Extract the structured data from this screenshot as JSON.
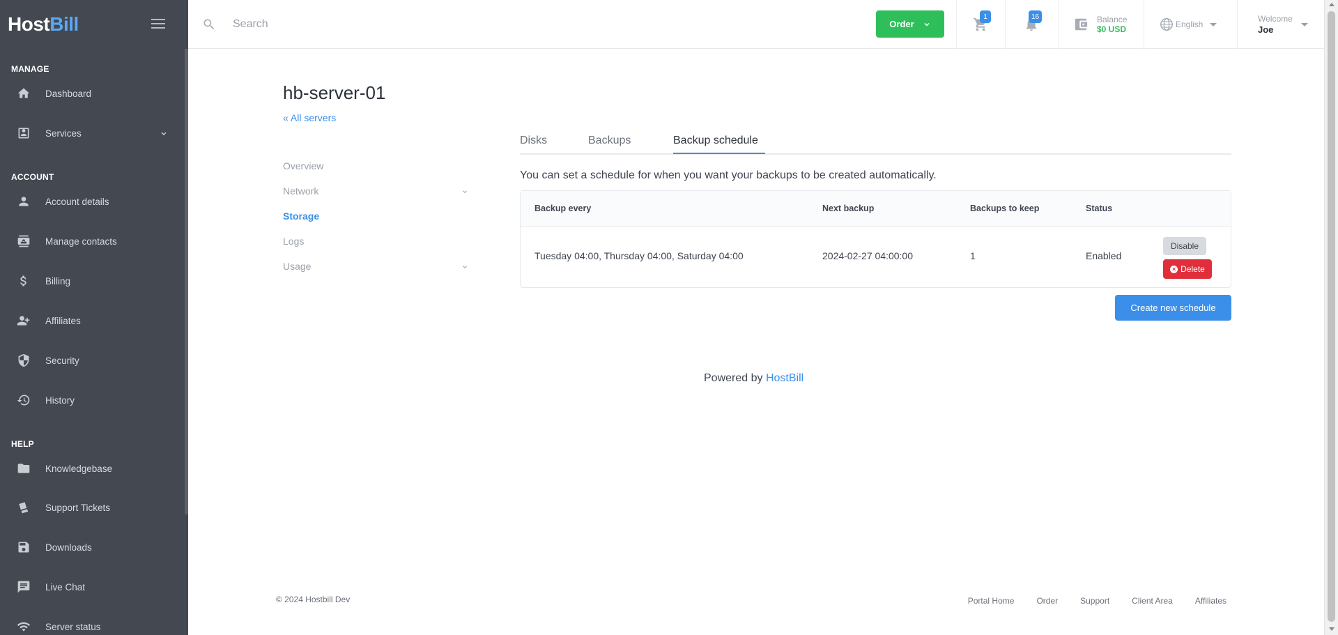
{
  "sidebar": {
    "logo_host": "Host",
    "logo_bill": "Bill",
    "sections": {
      "manage": "MANAGE",
      "account": "ACCOUNT",
      "help": "HELP"
    },
    "items": [
      {
        "label": "Dashboard",
        "icon": "home-icon"
      },
      {
        "label": "Services",
        "icon": "services-icon"
      },
      {
        "label": "Account details",
        "icon": "person-icon"
      },
      {
        "label": "Manage contacts",
        "icon": "contacts-icon"
      },
      {
        "label": "Billing",
        "icon": "dollar-icon"
      },
      {
        "label": "Affiliates",
        "icon": "affiliates-icon"
      },
      {
        "label": "Security",
        "icon": "shield-icon"
      },
      {
        "label": "History",
        "icon": "history-icon"
      },
      {
        "label": "Knowledgebase",
        "icon": "folder-icon"
      },
      {
        "label": "Support Tickets",
        "icon": "ticket-icon"
      },
      {
        "label": "Downloads",
        "icon": "save-icon"
      },
      {
        "label": "Live Chat",
        "icon": "chat-icon"
      },
      {
        "label": "Server status",
        "icon": "wifi-icon"
      }
    ]
  },
  "header": {
    "search_placeholder": "Search",
    "order_label": "Order",
    "cart_count": "1",
    "notifications_count": "16",
    "balance_label": "Balance",
    "balance_value": "$0 USD",
    "language": "English",
    "welcome_label": "Welcome",
    "user_name": "Joe"
  },
  "page": {
    "title": "hb-server-01",
    "back_link": "« All servers",
    "subnav": [
      "Overview",
      "Network",
      "Storage",
      "Logs",
      "Usage"
    ],
    "active_subnav": "Storage",
    "tabs": [
      "Disks",
      "Backups",
      "Backup schedule"
    ],
    "active_tab": "Backup schedule",
    "intro": "You can set a schedule for when you want your backups to be created automatically.",
    "table": {
      "headers": [
        "Backup every",
        "Next backup",
        "Backups to keep",
        "Status"
      ],
      "rows": [
        {
          "backup_every": "Tuesday 04:00, Thursday 04:00, Saturday 04:00",
          "next_backup": "2024-02-27 04:00:00",
          "backups_to_keep": "1",
          "status": "Enabled",
          "disable_label": "Disable",
          "delete_label": "Delete"
        }
      ]
    },
    "create_button": "Create new schedule",
    "powered_by": "Powered by",
    "powered_brand": "HostBill"
  },
  "footer": {
    "copyright": "© 2024 Hostbill Dev",
    "links": [
      "Portal Home",
      "Order",
      "Support",
      "Client Area",
      "Affiliates"
    ]
  },
  "colors": {
    "sidebar_bg": "#434851",
    "accent": "#3c8fe8",
    "order_green": "#2fbf5a",
    "delete_red": "#e02f3b"
  }
}
